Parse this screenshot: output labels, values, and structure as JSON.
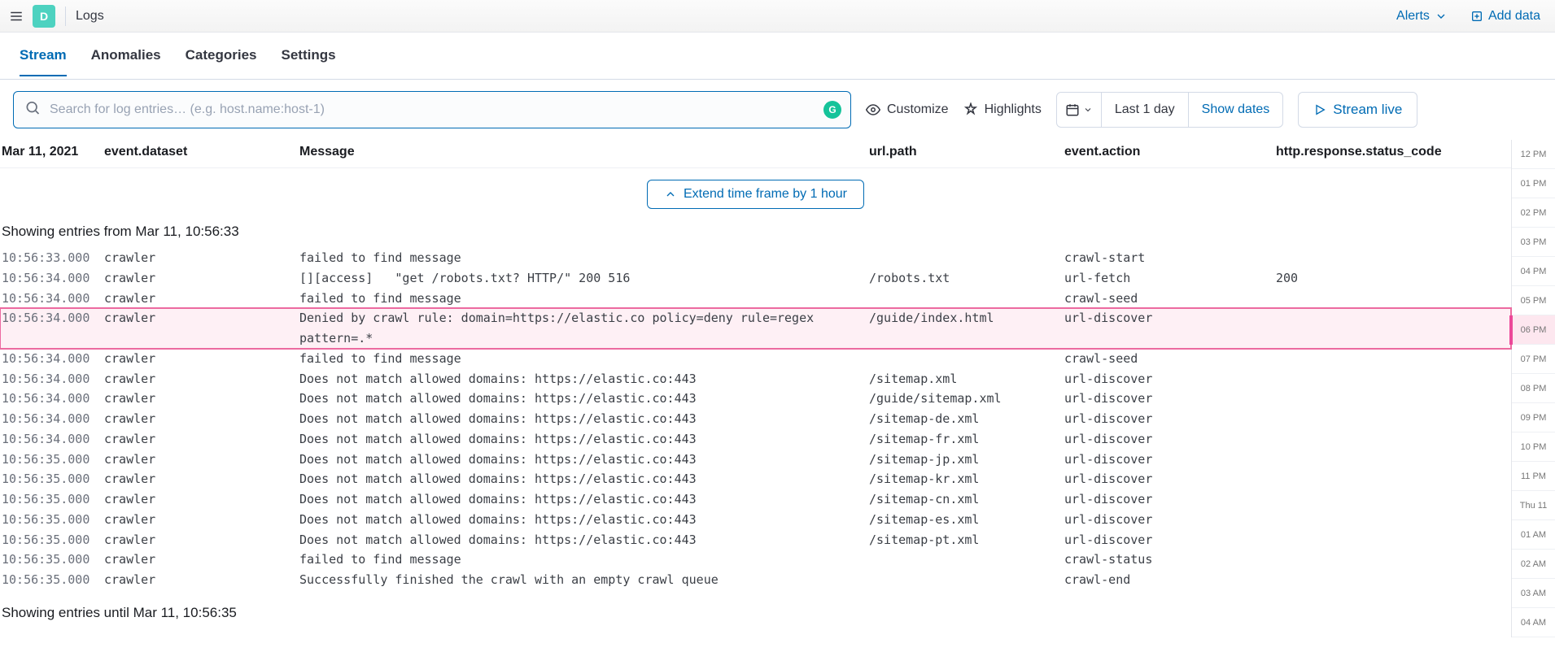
{
  "header": {
    "app_initial": "D",
    "breadcrumb": "Logs",
    "alerts_label": "Alerts",
    "add_data_label": "Add data"
  },
  "tabs": [
    {
      "label": "Stream",
      "active": true
    },
    {
      "label": "Anomalies",
      "active": false
    },
    {
      "label": "Categories",
      "active": false
    },
    {
      "label": "Settings",
      "active": false
    }
  ],
  "toolbar": {
    "search_placeholder": "Search for log entries… (e.g. host.name:host-1)",
    "customize_label": "Customize",
    "highlights_label": "Highlights",
    "date_range": "Last 1 day",
    "show_dates_label": "Show dates",
    "stream_live_label": "Stream live"
  },
  "columns": {
    "date": "Mar 11, 2021",
    "dataset": "event.dataset",
    "message": "Message",
    "url": "url.path",
    "action": "event.action",
    "status": "http.response.status_code"
  },
  "extend_label": "Extend time frame by 1 hour",
  "showing_from": "Showing entries from Mar 11, 10:56:33",
  "showing_until": "Showing entries until Mar 11, 10:56:35",
  "logs": [
    {
      "time": "10:56:33.000",
      "dataset": "crawler",
      "message": "failed to find message",
      "url": "",
      "action": "crawl-start",
      "status": "",
      "highlight": false
    },
    {
      "time": "10:56:34.000",
      "dataset": "crawler",
      "message": "[][access]   \"get /robots.txt? HTTP/\" 200 516",
      "url": "/robots.txt",
      "action": "url-fetch",
      "status": "200",
      "highlight": false
    },
    {
      "time": "10:56:34.000",
      "dataset": "crawler",
      "message": "failed to find message",
      "url": "",
      "action": "crawl-seed",
      "status": "",
      "highlight": false
    },
    {
      "time": "10:56:34.000",
      "dataset": "crawler",
      "message": "Denied by crawl rule: domain=https://elastic.co policy=deny rule=regex pattern=.*",
      "url": "/guide/index.html",
      "action": "url-discover",
      "status": "",
      "highlight": true
    },
    {
      "time": "10:56:34.000",
      "dataset": "crawler",
      "message": "failed to find message",
      "url": "",
      "action": "crawl-seed",
      "status": "",
      "highlight": false
    },
    {
      "time": "10:56:34.000",
      "dataset": "crawler",
      "message": "Does not match allowed domains: https://elastic.co:443",
      "url": "/sitemap.xml",
      "action": "url-discover",
      "status": "",
      "highlight": false
    },
    {
      "time": "10:56:34.000",
      "dataset": "crawler",
      "message": "Does not match allowed domains: https://elastic.co:443",
      "url": "/guide/sitemap.xml",
      "action": "url-discover",
      "status": "",
      "highlight": false
    },
    {
      "time": "10:56:34.000",
      "dataset": "crawler",
      "message": "Does not match allowed domains: https://elastic.co:443",
      "url": "/sitemap-de.xml",
      "action": "url-discover",
      "status": "",
      "highlight": false
    },
    {
      "time": "10:56:34.000",
      "dataset": "crawler",
      "message": "Does not match allowed domains: https://elastic.co:443",
      "url": "/sitemap-fr.xml",
      "action": "url-discover",
      "status": "",
      "highlight": false
    },
    {
      "time": "10:56:35.000",
      "dataset": "crawler",
      "message": "Does not match allowed domains: https://elastic.co:443",
      "url": "/sitemap-jp.xml",
      "action": "url-discover",
      "status": "",
      "highlight": false
    },
    {
      "time": "10:56:35.000",
      "dataset": "crawler",
      "message": "Does not match allowed domains: https://elastic.co:443",
      "url": "/sitemap-kr.xml",
      "action": "url-discover",
      "status": "",
      "highlight": false
    },
    {
      "time": "10:56:35.000",
      "dataset": "crawler",
      "message": "Does not match allowed domains: https://elastic.co:443",
      "url": "/sitemap-cn.xml",
      "action": "url-discover",
      "status": "",
      "highlight": false
    },
    {
      "time": "10:56:35.000",
      "dataset": "crawler",
      "message": "Does not match allowed domains: https://elastic.co:443",
      "url": "/sitemap-es.xml",
      "action": "url-discover",
      "status": "",
      "highlight": false
    },
    {
      "time": "10:56:35.000",
      "dataset": "crawler",
      "message": "Does not match allowed domains: https://elastic.co:443",
      "url": "/sitemap-pt.xml",
      "action": "url-discover",
      "status": "",
      "highlight": false
    },
    {
      "time": "10:56:35.000",
      "dataset": "crawler",
      "message": "failed to find message",
      "url": "",
      "action": "crawl-status",
      "status": "",
      "highlight": false
    },
    {
      "time": "10:56:35.000",
      "dataset": "crawler",
      "message": "Successfully finished the crawl with an empty crawl queue",
      "url": "",
      "action": "crawl-end",
      "status": "",
      "highlight": false
    }
  ],
  "minimap": [
    "12 PM",
    "01 PM",
    "02 PM",
    "03 PM",
    "04 PM",
    "05 PM",
    "06 PM",
    "07 PM",
    "08 PM",
    "09 PM",
    "10 PM",
    "11 PM",
    "Thu 11",
    "01 AM",
    "02 AM",
    "03 AM",
    "04 AM"
  ],
  "minimap_highlight_index": 6
}
